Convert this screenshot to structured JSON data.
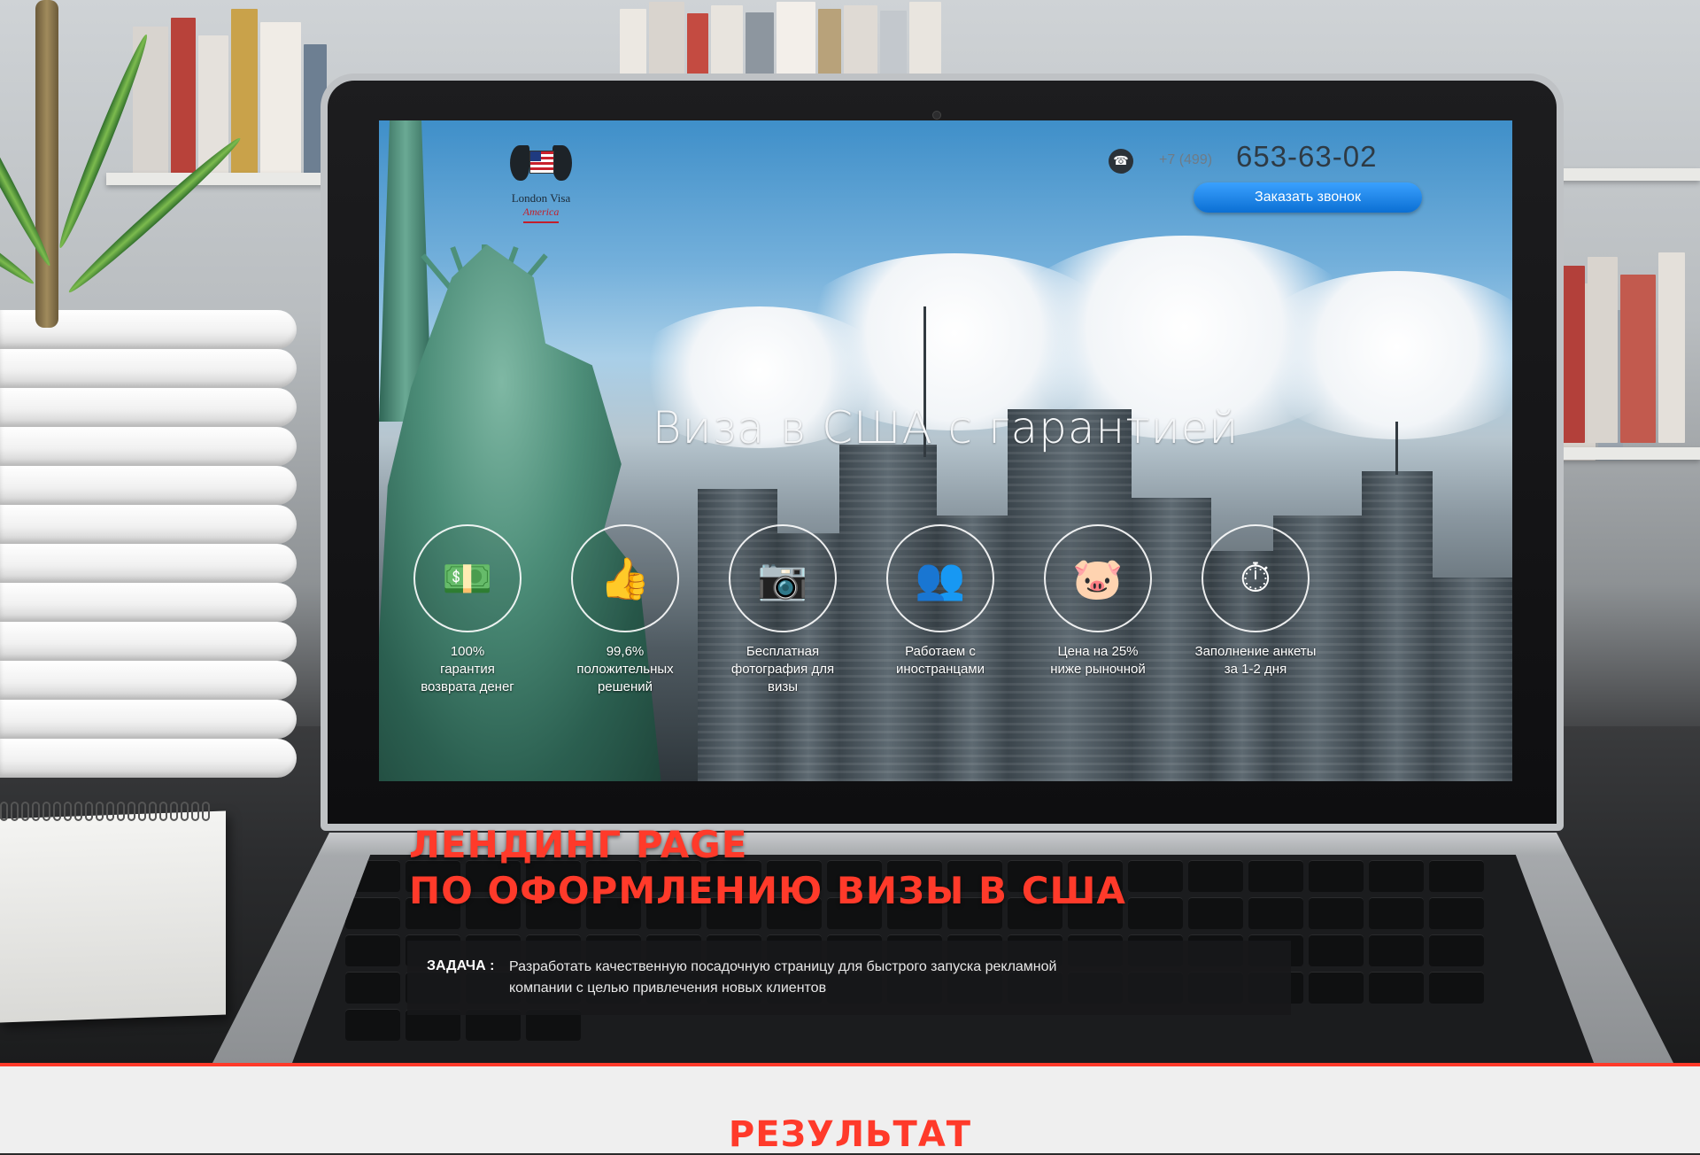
{
  "site": {
    "logo_title": "London Visa",
    "logo_subtitle": "America",
    "phone_code": "+7 (499)",
    "phone_number": "653-63-02",
    "callback_label": "Заказать звонок",
    "hero_title": "Виза в США с гарантией",
    "features": [
      {
        "icon": "money-icon",
        "glyph": "💵",
        "label": "100%\nгарантия\nвозврата денег"
      },
      {
        "icon": "thumbs-up-icon",
        "glyph": "👍",
        "label": "99,6%\nположительных\nрешений"
      },
      {
        "icon": "camera-icon",
        "glyph": "📷",
        "label": "Бесплатная\nфотография для\nвизы"
      },
      {
        "icon": "people-icon",
        "glyph": "👥",
        "label": "Работаем с\nиностранцами"
      },
      {
        "icon": "piggy-bank-icon",
        "glyph": "🐷",
        "label": "Цена на 25%\nниже рыночной"
      },
      {
        "icon": "speedometer-icon",
        "glyph": "⏱",
        "label": "Заполнение анкеты\nза 1-2 дня"
      }
    ]
  },
  "case": {
    "title_line1": "Лендинг page",
    "title_line2": "по оформлению визы в США",
    "task_label": "ЗАДАЧА :",
    "task_text": "Разработать качественную посадочную страницу для быстрого запуска рекламной компании с целью привлечения новых клиентов"
  },
  "result": {
    "title": "РЕЗУЛЬТАТ"
  },
  "colors": {
    "accent": "#ff3a2a",
    "button": "#1a85e6",
    "sky": "#74b0db"
  }
}
